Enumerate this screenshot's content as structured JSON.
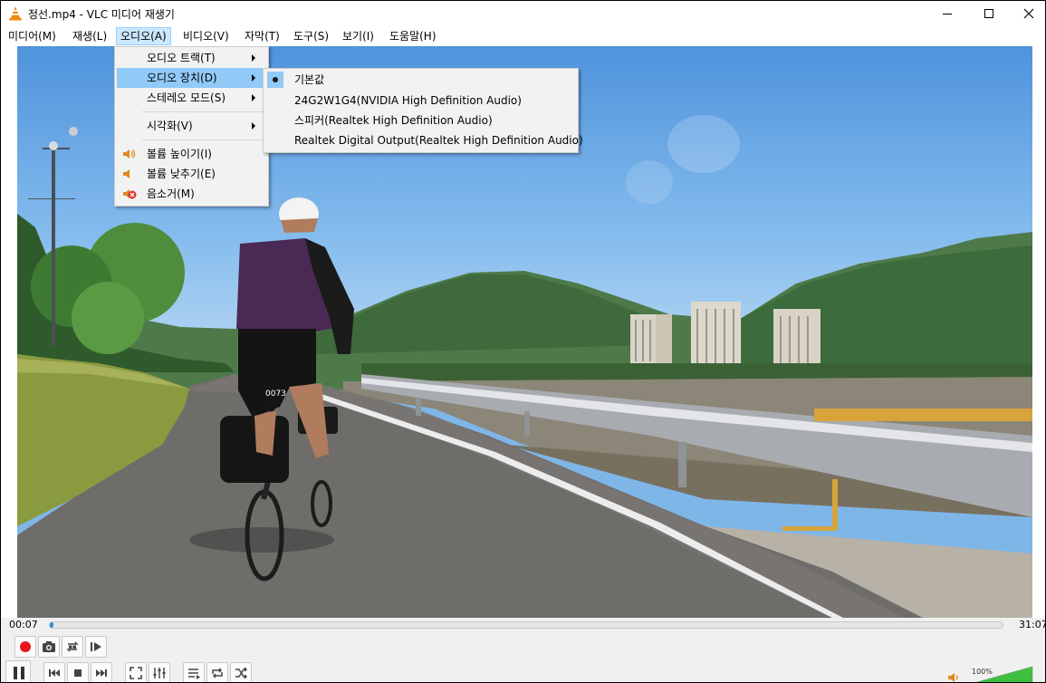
{
  "window": {
    "title": "정선.mp4 - VLC 미디어 재생기",
    "controls": {
      "minimize": "—",
      "maximize": "☐",
      "close": "✕"
    }
  },
  "menubar": {
    "items": [
      {
        "label": "미디어(M)"
      },
      {
        "label": "재생(L)"
      },
      {
        "label": "오디오(A)"
      },
      {
        "label": "비디오(V)"
      },
      {
        "label": "자막(T)"
      },
      {
        "label": "도구(S)"
      },
      {
        "label": "보기(I)"
      },
      {
        "label": "도움말(H)"
      }
    ]
  },
  "audio_menu": {
    "items": [
      {
        "label": "오디오 트랙(T)"
      },
      {
        "label": "오디오 장치(D)"
      },
      {
        "label": "스테레오 모드(S)"
      },
      {
        "label": "시각화(V)"
      },
      {
        "label": "볼륨 높이기(I)"
      },
      {
        "label": "볼륨 낮추기(E)"
      },
      {
        "label": "음소거(M)"
      }
    ]
  },
  "device_menu": {
    "items": [
      {
        "label": "기본값",
        "selected": true
      },
      {
        "label": "24G2W1G4(NVIDIA High Definition Audio)"
      },
      {
        "label": "스피커(Realtek High Definition Audio)"
      },
      {
        "label": "Realtek Digital Output(Realtek High Definition Audio)"
      }
    ]
  },
  "playback": {
    "time_current": "00:07",
    "time_total": "31:07",
    "progress_fraction": 0.004,
    "volume_label": "100%",
    "volume_fraction": 1.0
  },
  "colors": {
    "record_red": "#e8141b",
    "menu_highlight": "#91c9f7",
    "seek_fill": "#3b8fd9",
    "volume_green": "#3fbf3f",
    "mute_red": "#d9342b"
  },
  "video_sign": {
    "bib_number": "0073"
  }
}
